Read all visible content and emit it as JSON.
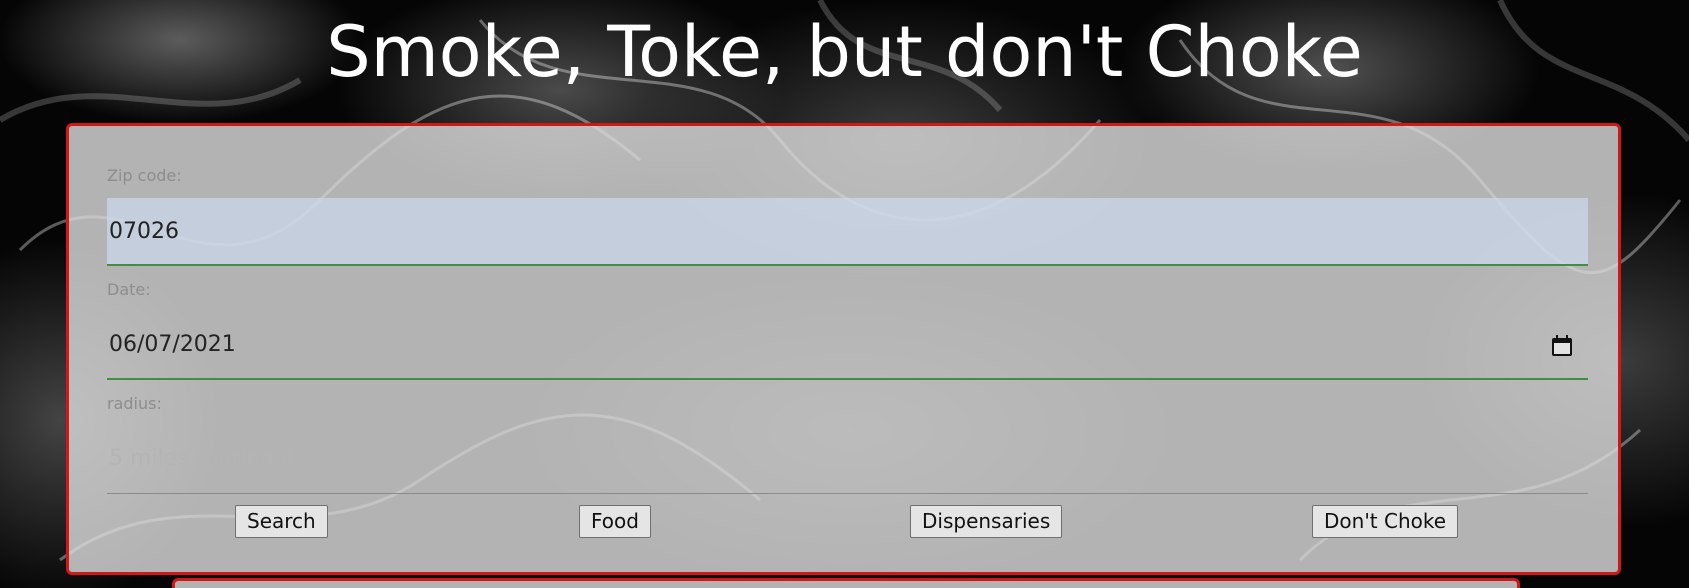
{
  "page": {
    "title": "Smoke, Toke, but don't Choke"
  },
  "form": {
    "zip": {
      "label": "Zip code:",
      "value": "07026"
    },
    "date": {
      "label": "Date:",
      "value": "06/07/2021",
      "icon": "calendar-icon"
    },
    "radius": {
      "label": "radius:",
      "placeholder": "5 miles (optional"
    },
    "buttons": {
      "search": "Search",
      "food": "Food",
      "dispensaries": "Dispensaries",
      "dont_choke": "Don't Choke"
    }
  },
  "colors": {
    "panel_border": "#d01818",
    "input_underline_valid": "#3f8f3f",
    "zip_fill": "#cddaf0"
  }
}
